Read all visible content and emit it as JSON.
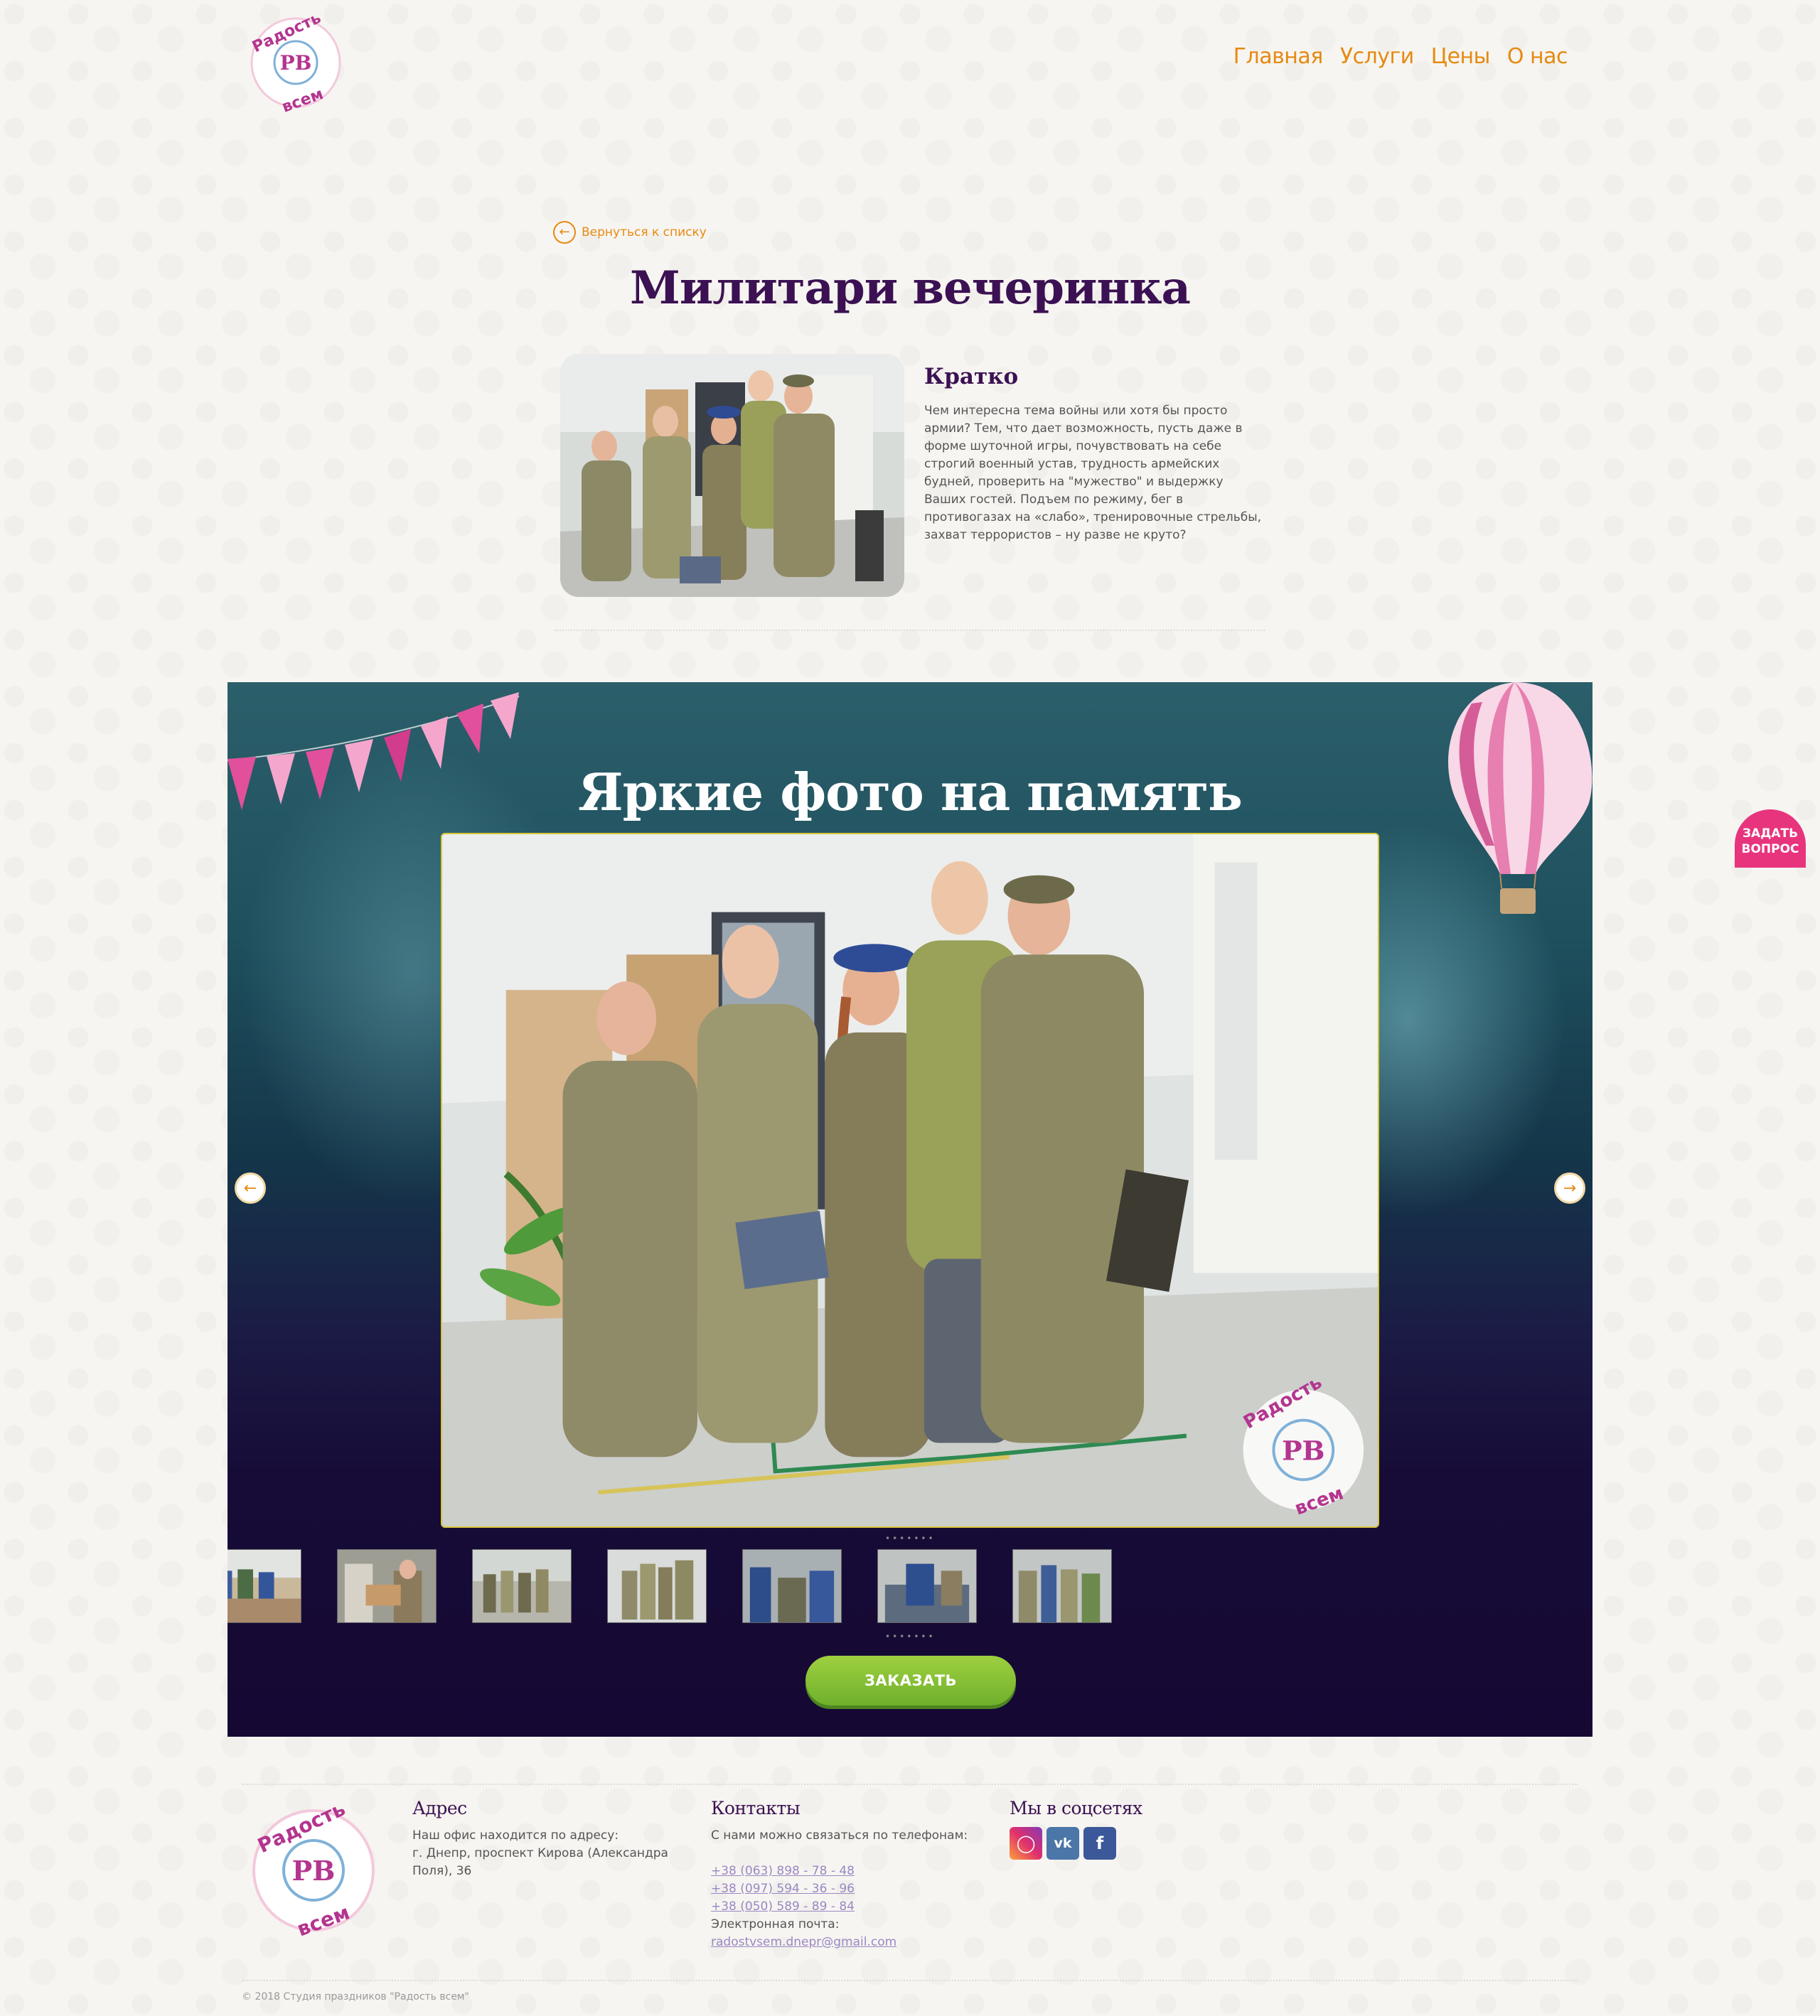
{
  "header": {
    "logo_top_text": "Радость",
    "logo_initials": "РВ",
    "logo_bottom_text": "всем",
    "nav": [
      "Главная",
      "Услуги",
      "Цены",
      "О нас"
    ]
  },
  "back_link": {
    "label": "Вернуться к списку"
  },
  "page_title": "Милитари вечеринка",
  "intro": {
    "heading": "Кратко",
    "text": "Чем интересна тема войны или хотя бы просто армии? Тем, что дает возможность, пусть даже в форме шуточной игры, почувствовать на себе строгий военный устав, трудность армейских будней, проверить на \"мужество\" и выдержку Ваших гостей. Подъем по режиму, бег в противогазах на «слабо», тренировочные стрельбы, захват террористов – ну разве не круто?"
  },
  "gallery": {
    "title": "Яркие фото на память",
    "watermark_top": "Радость",
    "watermark_initials": "РВ",
    "watermark_bottom": "всем",
    "order_button": "ЗАКАЗАТЬ"
  },
  "ask_button": {
    "line1": "ЗАДАТЬ",
    "line2": "ВОПРОС"
  },
  "footer": {
    "address": {
      "heading": "Адрес",
      "line1": "Наш офис находится по адресу:",
      "line2": "г. Днепр, проспект Кирова (Александра Поля), 36"
    },
    "contacts": {
      "heading": "Контакты",
      "intro": "С нами можно связаться по телефонам:",
      "phones": [
        "+38 (063) 898 - 78 - 48",
        "+38 (097) 594 - 36 - 96",
        "+38 (050) 589 - 89 - 84"
      ],
      "email_label": "Электронная почта:",
      "email": "radostvsem.dnepr@gmail.com"
    },
    "social": {
      "heading": "Мы в соцсетях",
      "icons": [
        "instagram-icon",
        "vk-icon",
        "facebook-icon"
      ]
    },
    "copyright": "© 2018 Студия праздников \"Радость всем\""
  },
  "colors": {
    "accent_orange": "#e58a12",
    "title_purple": "#3b1153",
    "pink": "#e7347d",
    "green_button": "#8cc63f"
  }
}
